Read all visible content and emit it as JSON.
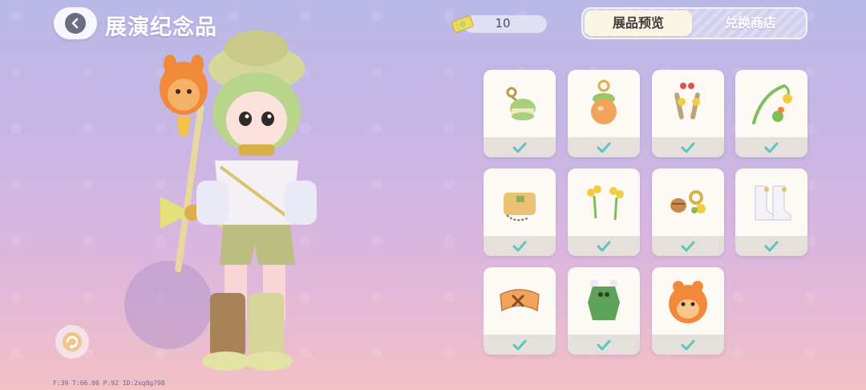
{
  "header": {
    "title": "展演纪念品",
    "currency_value": "10"
  },
  "tabs": [
    {
      "label": "展品预览",
      "active": true
    },
    {
      "label": "兑换商店",
      "active": false
    }
  ],
  "debug_text": "F:39  T:66.00  P:92  ID:2xq8g798",
  "items": [
    {
      "name": "green-cake-keychain",
      "collected": true
    },
    {
      "name": "orange-acorn-charm",
      "collected": true
    },
    {
      "name": "flower-hairpins",
      "collected": true
    },
    {
      "name": "flower-wand",
      "collected": true
    },
    {
      "name": "tan-bag",
      "collected": true
    },
    {
      "name": "yellow-flower-pair",
      "collected": true
    },
    {
      "name": "acorn-rings",
      "collected": true
    },
    {
      "name": "white-boots",
      "collected": true
    },
    {
      "name": "orange-bracelet",
      "collected": true
    },
    {
      "name": "green-frog-top",
      "collected": true
    },
    {
      "name": "orange-bear-hat",
      "collected": true
    }
  ],
  "colors": {
    "check": "#5cc3bd",
    "card_bg": "#fdfaf5",
    "status_bg": "#e5e0dc",
    "active_tab_bg": "#fbf5e6"
  }
}
